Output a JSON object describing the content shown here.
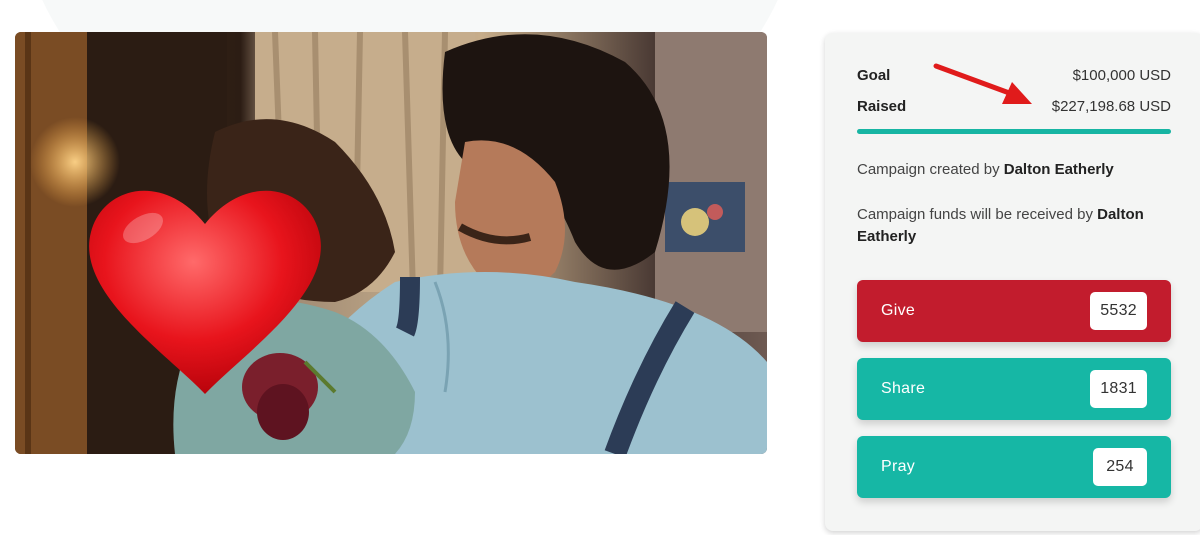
{
  "campaign": {
    "goal_label": "Goal",
    "goal_value": "$100,000 USD",
    "raised_label": "Raised",
    "raised_value": "$227,198.68 USD",
    "progress_fraction": 1.0,
    "created_prefix": "Campaign created by ",
    "creator": "Dalton Eatherly",
    "funds_prefix": "Campaign funds will be received by ",
    "recipient": "Dalton Eatherly"
  },
  "actions": {
    "give_label": "Give",
    "give_count": "5532",
    "share_label": "Share",
    "share_count": "1831",
    "pray_label": "Pray",
    "pray_count": "254"
  },
  "colors": {
    "give": "#c21c2d",
    "accent": "#16b7a5",
    "arrow": "#e01b1b"
  },
  "icons": [
    "heart-emoji",
    "red-arrow"
  ]
}
